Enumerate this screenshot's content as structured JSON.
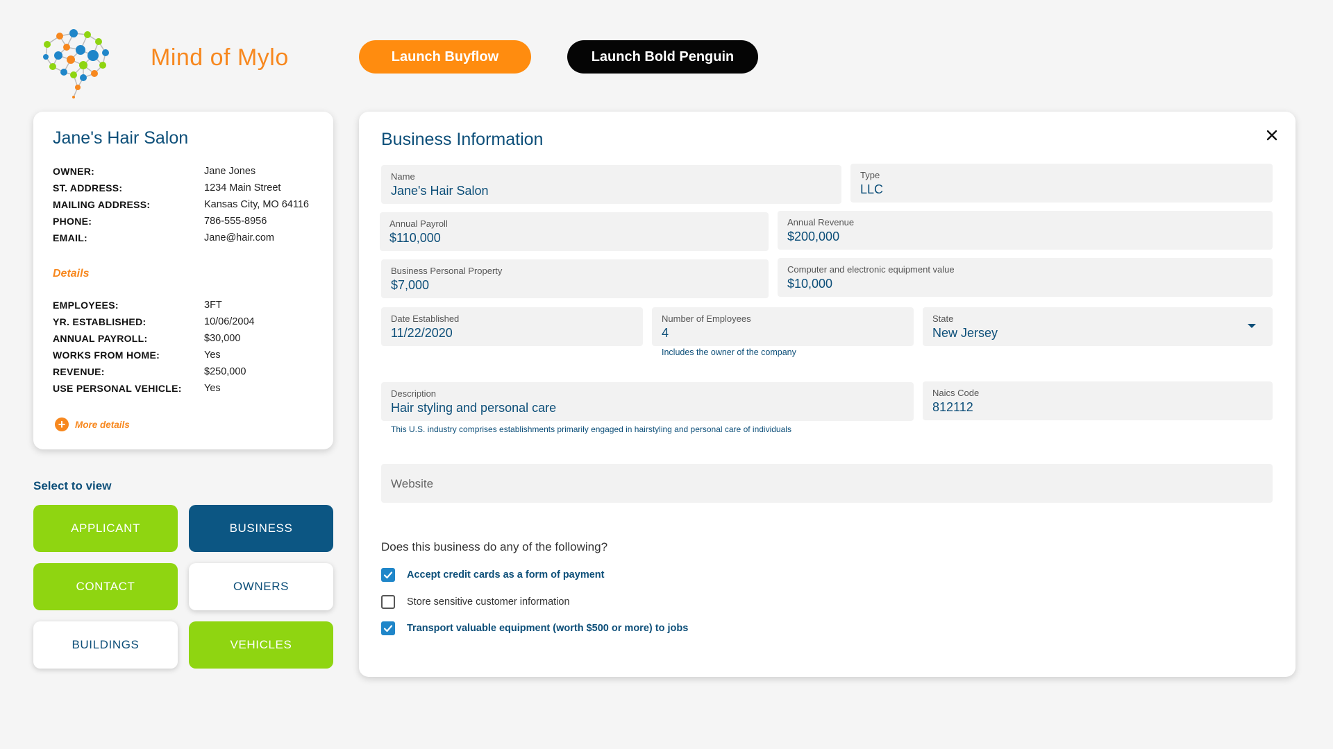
{
  "header": {
    "brand_title": "Mind of Mylo",
    "launch_buyflow": "Launch Buyflow",
    "launch_bold_penguin": "Launch Bold Penguin",
    "colors": {
      "orange": "#ff8c0f",
      "black": "#050505",
      "navy": "#0d4f79",
      "green": "#8fd511",
      "blue_tile": "#0c5683"
    }
  },
  "summary": {
    "title": "Jane's Hair Salon",
    "contact": [
      {
        "key": "OWNER:",
        "value": "Jane Jones"
      },
      {
        "key": "ST. ADDRESS:",
        "value": "1234 Main Street"
      },
      {
        "key": "MAILING ADDRESS:",
        "value": "Kansas City, MO 64116"
      },
      {
        "key": "PHONE:",
        "value": "786-555-8956"
      },
      {
        "key": "EMAIL:",
        "value": "Jane@hair.com"
      }
    ],
    "details_label": "Details",
    "details": [
      {
        "key": "EMPLOYEES:",
        "value": "3FT"
      },
      {
        "key": "YR. ESTABLISHED:",
        "value": "10/06/2004"
      },
      {
        "key": "ANNUAL PAYROLL:",
        "value": "$30,000"
      },
      {
        "key": "WORKS FROM HOME:",
        "value": "Yes"
      },
      {
        "key": "REVENUE:",
        "value": "$250,000"
      },
      {
        "key": "USE PERSONAL VEHICLE:",
        "value": "Yes"
      }
    ],
    "more_details": "More details"
  },
  "select_view": {
    "label": "Select to view",
    "tiles": {
      "applicant": "APPLICANT",
      "business": "BUSINESS",
      "contact": "CONTACT",
      "owners": "OWNERS",
      "buildings": "BUILDINGS",
      "vehicles": "VEHICLES"
    },
    "selected": "BUSINESS"
  },
  "business_info": {
    "title": "Business Information",
    "fields": {
      "name": {
        "label": "Name",
        "value": "Jane's Hair Salon"
      },
      "type": {
        "label": "Type",
        "value": "LLC"
      },
      "annual_payroll": {
        "label": "Annual Payroll",
        "value": "$110,000"
      },
      "annual_revenue": {
        "label": "Annual Revenue",
        "value": "$200,000"
      },
      "bpp": {
        "label": "Business Personal Property",
        "value": "$7,000"
      },
      "computer_equipment": {
        "label": "Computer and electronic equipment value",
        "value": "$10,000"
      },
      "date_established": {
        "label": "Date Established",
        "value": "11/22/2020"
      },
      "num_employees": {
        "label": "Number of Employees",
        "value": "4",
        "hint": "Includes the owner of the company"
      },
      "state": {
        "label": "State",
        "value": "New Jersey"
      },
      "description": {
        "label": "Description",
        "value": "Hair styling and personal care",
        "hint": "This U.S. industry comprises establishments primarily engaged in hairstyling and personal care of individuals"
      },
      "naics": {
        "label": "Naics Code",
        "value": "812112"
      },
      "website": {
        "placeholder": "Website"
      }
    },
    "question": "Does this business do any of the following?",
    "checkboxes": [
      {
        "label": "Accept credit cards as a form of payment",
        "checked": true
      },
      {
        "label": "Store sensitive customer information",
        "checked": false
      },
      {
        "label": "Transport valuable equipment (worth $500 or more) to jobs",
        "checked": true
      }
    ]
  }
}
